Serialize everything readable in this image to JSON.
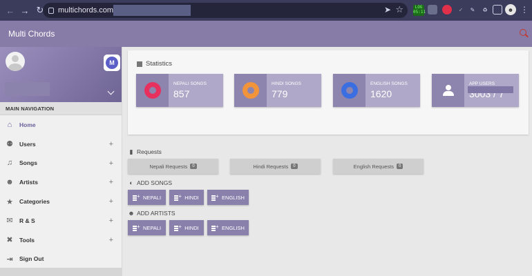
{
  "browser": {
    "url": "multichords.com",
    "ext_badge": "LOG 05:11"
  },
  "header": {
    "title": "Multi Chords"
  },
  "sidebar": {
    "nav_header": "MAIN NAVIGATION",
    "items": [
      {
        "label": "Home",
        "icon": "home-icon",
        "active": true
      },
      {
        "label": "Users",
        "icon": "users-icon"
      },
      {
        "label": "Songs",
        "icon": "music-library-icon"
      },
      {
        "label": "Artists",
        "icon": "artist-icon"
      },
      {
        "label": "Categories",
        "icon": "folder-star-icon"
      },
      {
        "label": "R & S",
        "icon": "forum-icon"
      },
      {
        "label": "Tools",
        "icon": "tools-icon"
      },
      {
        "label": "Sign Out",
        "icon": "sign-out-icon"
      }
    ]
  },
  "statistics": {
    "title": "Statistics",
    "cards": [
      {
        "label": "NEPALI SONGS",
        "value": "857",
        "color": "#e8305f"
      },
      {
        "label": "HINDI SONGS",
        "value": "779",
        "color": "#f2943a"
      },
      {
        "label": "ENGLISH SONGS",
        "value": "1620",
        "color": "#3b6ee0"
      },
      {
        "label": "APP USERS",
        "value": "3003 / 7"
      }
    ]
  },
  "requests": {
    "title": "Requests",
    "buttons": [
      {
        "label": "Nepali Requests",
        "count": "0"
      },
      {
        "label": "Hindi Requests",
        "count": "0"
      },
      {
        "label": "English Requests",
        "count": "0"
      }
    ]
  },
  "add_songs": {
    "title": "ADD SONGS",
    "buttons": [
      "NEPALI",
      "HINDI",
      "ENGLISH"
    ]
  },
  "add_artists": {
    "title": "ADD ARTISTS",
    "buttons": [
      "NEPALI",
      "HINDI",
      "ENGLISH"
    ]
  }
}
